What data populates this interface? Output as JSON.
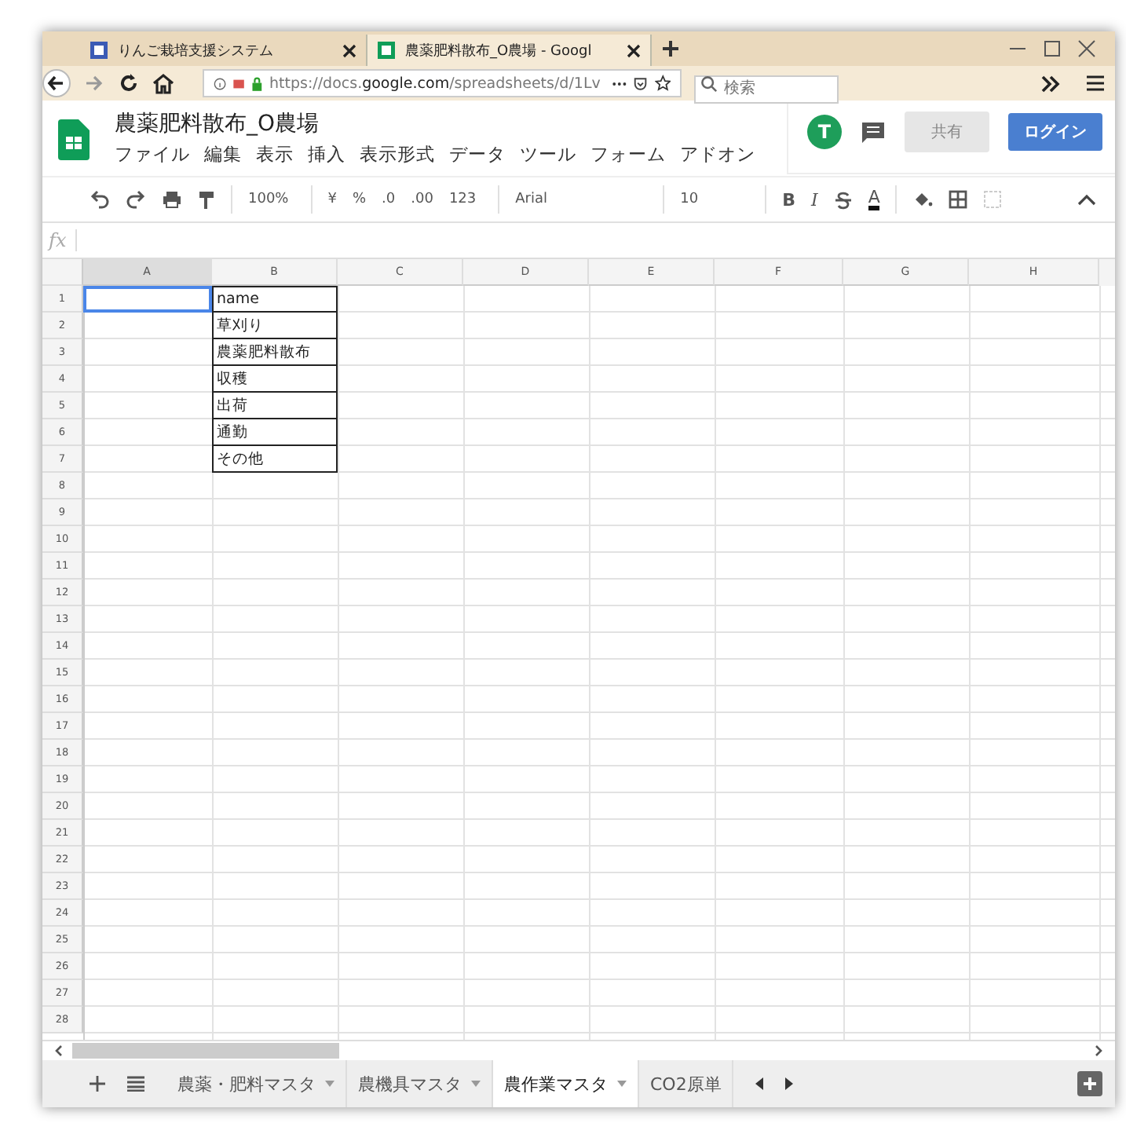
{
  "browser": {
    "tabs": [
      {
        "title": "りんご栽培支援システム",
        "selected": false
      },
      {
        "title": "農薬肥料散布_O農場 - Googl",
        "selected": true
      }
    ],
    "url": "https://docs.**google.com**/spreadsheets/d/1Lv",
    "search": {
      "placeholder": "検索"
    }
  },
  "doc": {
    "title": "農薬肥料散布_O農場",
    "menu": [
      "ファイル",
      "編集",
      "表示",
      "挿入",
      "表示形式",
      "データ",
      "ツール",
      "フォーム",
      "アドオン"
    ],
    "avatar": "T",
    "share": {
      "label": "共有",
      "disabled": true
    },
    "login": "ログイン"
  },
  "toolbar": {
    "zoom": "100%",
    "currency": "¥",
    "percent": "%",
    "decrease_decimals": ".0",
    "increase_decimals": ".00",
    "format": "123",
    "font": "Arial",
    "font_size": "10",
    "bold": "B",
    "italic": "I",
    "text_color": "A"
  },
  "formula_bar": {
    "label": "fx"
  },
  "table": {
    "columns": [
      "A",
      "B",
      "C",
      "D",
      "E",
      "F",
      "G",
      "H"
    ],
    "rows": [
      {
        "label": "1",
        "column_b": "name",
        "bordered": true,
        "a_selected": true
      },
      {
        "label": "2",
        "column_b": "草刈り",
        "bordered": true,
        "a_selected": false
      },
      {
        "label": "3",
        "column_b": "農薬肥料散布",
        "bordered": true,
        "a_selected": false
      },
      {
        "label": "4",
        "column_b": "収穫",
        "bordered": true,
        "a_selected": false
      },
      {
        "label": "5",
        "column_b": "出荷",
        "bordered": true,
        "a_selected": false
      },
      {
        "label": "6",
        "column_b": "通勤",
        "bordered": true,
        "a_selected": false
      },
      {
        "label": "7",
        "column_b": "その他",
        "bordered": true,
        "a_selected": false
      },
      {
        "label": "8",
        "bordered": false,
        "a_selected": false
      },
      {
        "label": "9",
        "bordered": false,
        "a_selected": false
      },
      {
        "label": "10",
        "bordered": false,
        "a_selected": false
      },
      {
        "label": "11",
        "bordered": false,
        "a_selected": false
      },
      {
        "label": "12",
        "bordered": false,
        "a_selected": false
      },
      {
        "label": "13",
        "bordered": false,
        "a_selected": false
      },
      {
        "label": "14",
        "bordered": false,
        "a_selected": false
      },
      {
        "label": "15",
        "bordered": false,
        "a_selected": false
      },
      {
        "label": "16",
        "bordered": false,
        "a_selected": false
      },
      {
        "label": "17",
        "bordered": false,
        "a_selected": false
      },
      {
        "label": "18",
        "bordered": false,
        "a_selected": false
      },
      {
        "label": "19",
        "bordered": false,
        "a_selected": false
      },
      {
        "label": "20",
        "bordered": false,
        "a_selected": false
      },
      {
        "label": "21",
        "bordered": false,
        "a_selected": false
      },
      {
        "label": "22",
        "bordered": false,
        "a_selected": false
      },
      {
        "label": "23",
        "bordered": false,
        "a_selected": false
      },
      {
        "label": "24",
        "bordered": false,
        "a_selected": false
      },
      {
        "label": "25",
        "bordered": false,
        "a_selected": false
      },
      {
        "label": "26",
        "bordered": false,
        "a_selected": false
      },
      {
        "label": "27",
        "bordered": false,
        "a_selected": false
      },
      {
        "label": "28",
        "bordered": false,
        "a_selected": false
      }
    ]
  },
  "sheet_tabs": [
    {
      "label": "農薬・肥料マスタ",
      "selected": false
    },
    {
      "label": "農機具マスタ",
      "selected": false
    },
    {
      "label": "農作業マスタ",
      "selected": true
    },
    {
      "label": "CO2原単",
      "selected": false
    }
  ]
}
